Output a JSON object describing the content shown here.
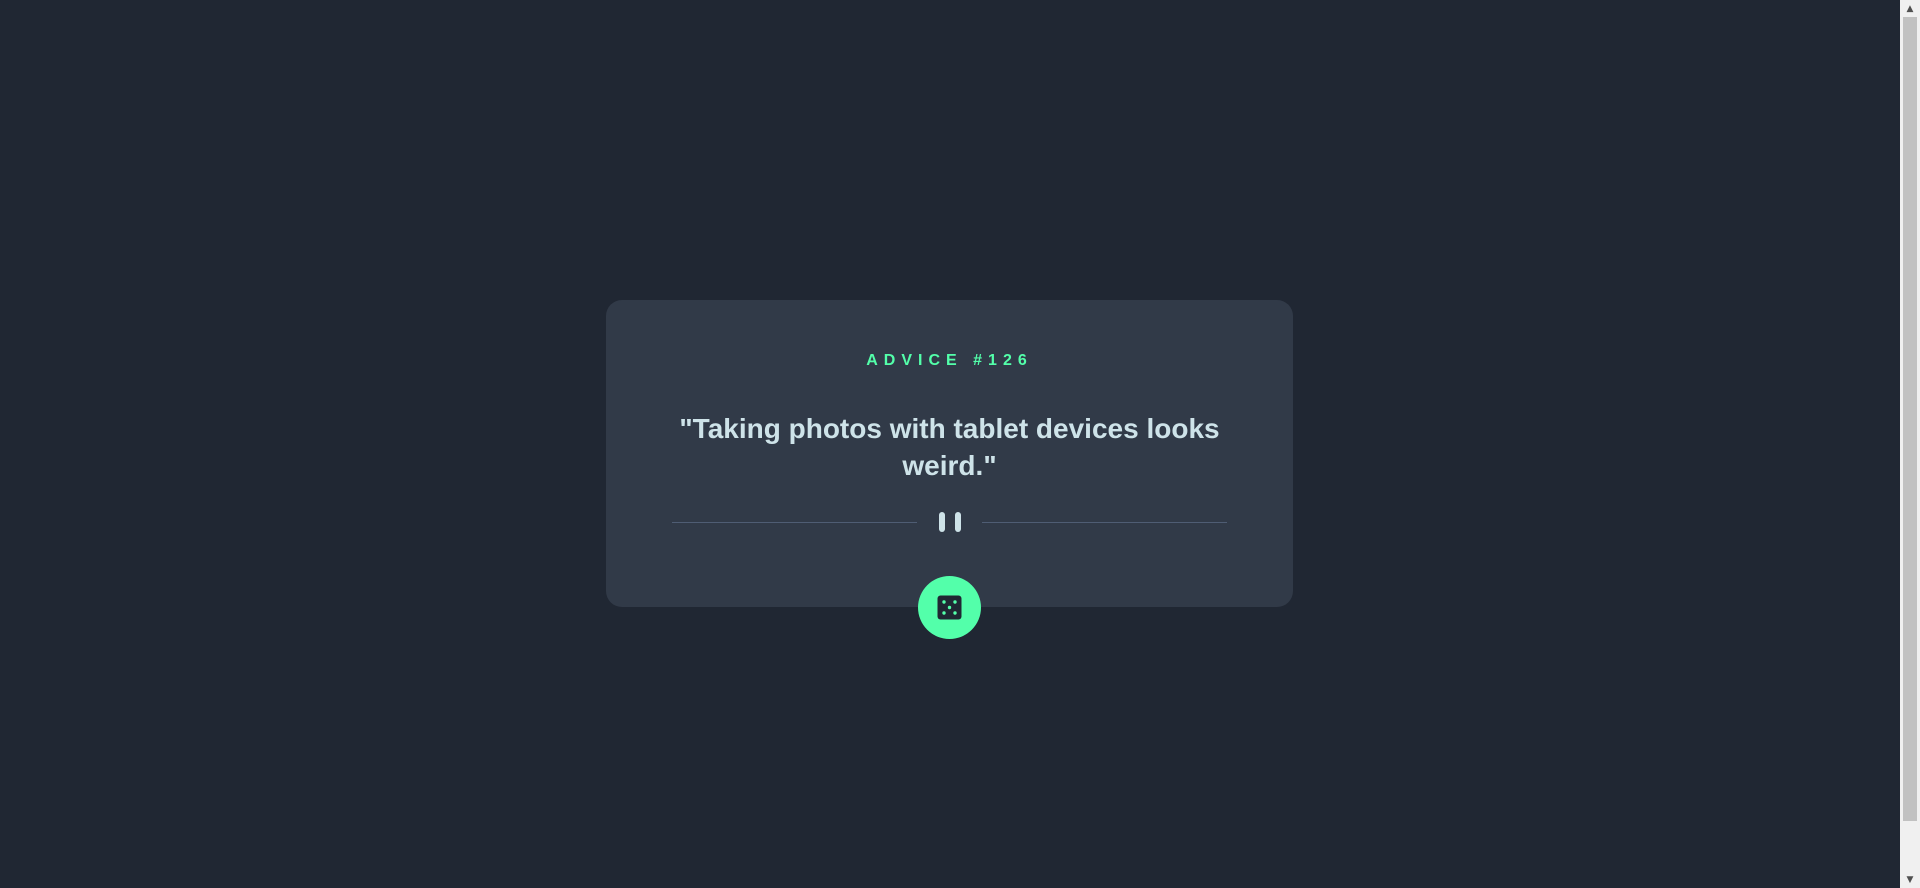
{
  "card": {
    "advice_id": "ADVICE #126",
    "quote": "\"Taking photos with tablet devices looks weird.\""
  },
  "divider": {
    "icon": "pause-icon"
  },
  "dice_button": {
    "icon": "dice-icon"
  },
  "colors": {
    "background": "#202733",
    "card": "#313a48",
    "accent": "#53ffaa",
    "text": "#cee3e9",
    "divider_line": "#4f5d74"
  }
}
